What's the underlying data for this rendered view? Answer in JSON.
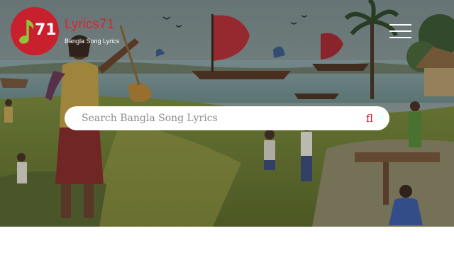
{
  "brand": {
    "name": "Lyrics71",
    "tagline": "Bangla Song Lyrics",
    "logo_number": "71",
    "color": "#c8202c"
  },
  "header": {
    "menu_icon": "hamburger-menu-icon"
  },
  "search": {
    "placeholder": "Search Bangla Song Lyrics",
    "value": "",
    "button_glyph": "fl",
    "button_icon": "search-icon"
  },
  "hero": {
    "image": "bengali-village-river-painting"
  }
}
